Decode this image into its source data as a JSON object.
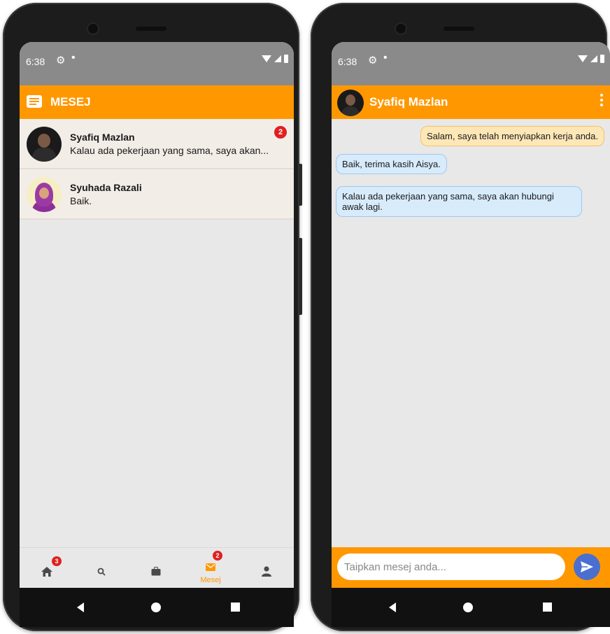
{
  "left_phone": {
    "status": {
      "time": "6:38",
      "gear": "⚙",
      "dot": "•"
    },
    "appbar": {
      "title": "MESEJ",
      "icon": "message-icon"
    },
    "messages": [
      {
        "name": "Syafiq Mazlan",
        "preview": "Kalau ada pekerjaan yang sama, saya akan...",
        "unread": "2"
      },
      {
        "name": "Syuhada Razali",
        "preview": "Baik.",
        "unread": ""
      }
    ],
    "nav": {
      "home": {
        "icon": "home-icon",
        "badge": "3"
      },
      "search": {
        "icon": "search-icon"
      },
      "jobs": {
        "icon": "briefcase-icon"
      },
      "messages": {
        "icon": "mail-icon",
        "label": "Mesej",
        "badge": "2"
      },
      "profile": {
        "icon": "person-icon"
      }
    }
  },
  "right_phone": {
    "status": {
      "time": "6:38",
      "gear": "⚙",
      "dot": "•"
    },
    "appbar": {
      "title": "Syafiq Mazlan"
    },
    "chat": [
      {
        "direction": "outgoing",
        "text": "Salam, saya telah menyiapkan kerja anda."
      },
      {
        "direction": "incoming",
        "text": "Baik, terima kasih Aisya."
      },
      {
        "direction": "incoming",
        "text": "Kalau ada pekerjaan yang sama, saya akan hubungi awak lagi."
      }
    ],
    "composer": {
      "placeholder": "Taipkan mesej anda..."
    }
  },
  "colors": {
    "accent": "#ff9800",
    "badge": "#e02020",
    "send": "#4a6fd0",
    "outgoing_bubble": "#fde7b7",
    "incoming_bubble": "#d7ebfb"
  }
}
